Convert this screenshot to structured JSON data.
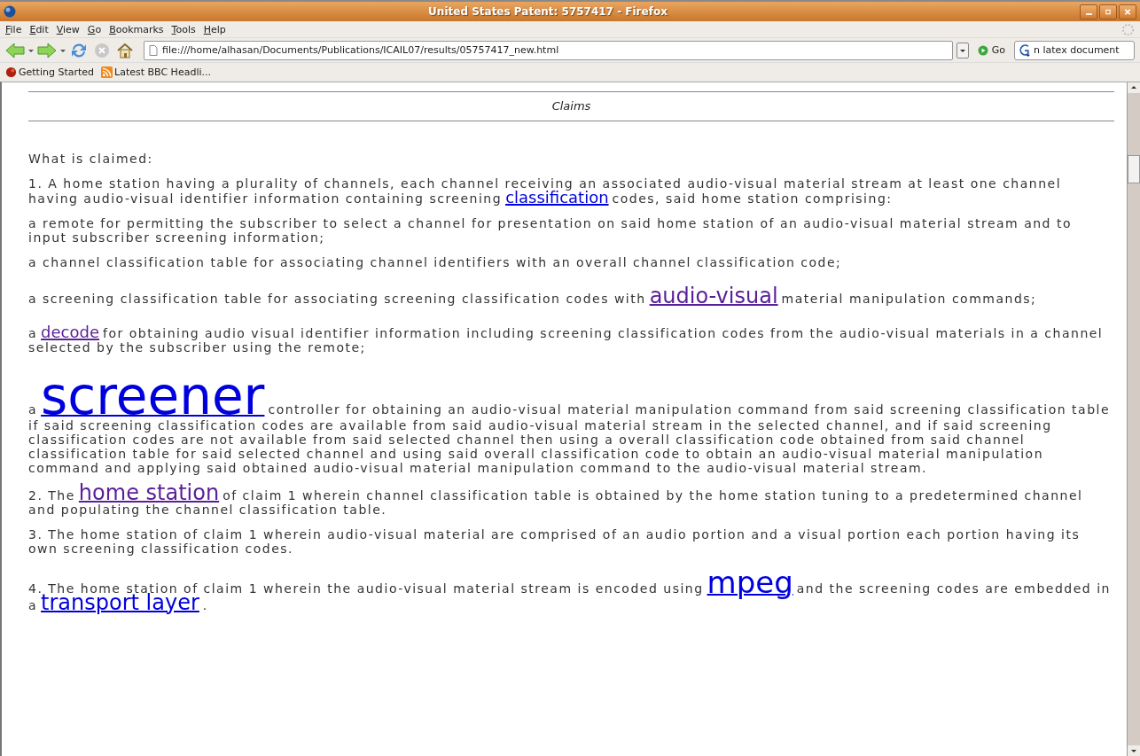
{
  "window": {
    "title": "United States Patent: 5757417 - Firefox"
  },
  "menu": [
    "File",
    "Edit",
    "View",
    "Go",
    "Bookmarks",
    "Tools",
    "Help"
  ],
  "address": {
    "value": "file:///home/alhasan/Documents/Publications/ICAIL07/results/05757417_new.html"
  },
  "go_button": "Go",
  "search": {
    "value": "n latex document"
  },
  "bookmarks": [
    {
      "label": "Getting Started",
      "kind": "page"
    },
    {
      "label": "Latest BBC Headli...",
      "kind": "feed"
    }
  ],
  "heading": "Claims",
  "paragraphs": [
    {
      "parts": [
        {
          "kind": "text",
          "text": "What is claimed:"
        }
      ]
    },
    {
      "parts": [
        {
          "kind": "text",
          "text": "1. A home station having a plurality of channels, each channel receiving an associated audio-visual material stream at least one channel having audio-visual identifier information containing screening"
        },
        {
          "kind": "small",
          "text": "classification",
          "visited": false
        },
        {
          "kind": "text",
          "text": "codes, said home station comprising:"
        }
      ]
    },
    {
      "parts": [
        {
          "kind": "text",
          "text": "a remote for permitting the subscriber to select a channel for presentation on said home station of an audio-visual material stream and to input subscriber screening information;"
        }
      ]
    },
    {
      "parts": [
        {
          "kind": "text",
          "text": "a channel classification table for associating channel identifiers with an overall channel classification code;"
        }
      ]
    },
    {
      "parts": [
        {
          "kind": "text",
          "text": "a screening classification table for associating screening classification codes with"
        },
        {
          "kind": "medium",
          "text": "audio-visual",
          "visited": true
        },
        {
          "kind": "text",
          "text": "material manipulation commands;"
        }
      ]
    },
    {
      "parts": [
        {
          "kind": "text",
          "text": "a"
        },
        {
          "kind": "small",
          "text": "decode",
          "visited": true
        },
        {
          "kind": "text",
          "text": "for obtaining audio visual identifier information including screening classification codes from the audio-visual materials in a channel selected by the subscriber using the remote;"
        }
      ]
    },
    {
      "parts": [
        {
          "kind": "text",
          "text": "a"
        },
        {
          "kind": "huge",
          "text": "screener",
          "visited": false
        },
        {
          "kind": "text",
          "text": "controller for obtaining an audio-visual material manipulation command from said screening classification table if said screening classification codes are available from said audio-visual material stream in the selected channel, and if said screening classification codes are not available from said selected channel then using a overall classification code obtained from said channel classification table for said selected channel and using said overall classification code to obtain an audio-visual material manipulation command and applying said obtained audio-visual material manipulation command to the audio-visual material stream."
        }
      ]
    },
    {
      "parts": [
        {
          "kind": "text",
          "text": "2. The"
        },
        {
          "kind": "medium",
          "text": "home station",
          "visited": true
        },
        {
          "kind": "text",
          "text": "of claim 1 wherein channel classification table is obtained by the home station tuning to a predetermined channel and populating the channel classification table."
        }
      ]
    },
    {
      "parts": [
        {
          "kind": "text",
          "text": "3. The home station of claim 1 wherein audio-visual material are comprised of an audio portion and a visual portion each portion having its own screening classification codes."
        }
      ]
    },
    {
      "parts": [
        {
          "kind": "text",
          "text": "4. The home station of claim 1 wherein the audio-visual material stream is encoded using"
        },
        {
          "kind": "large",
          "text": "mpeg",
          "visited": false
        },
        {
          "kind": "text",
          "text": "and the screening codes are embedded in a"
        },
        {
          "kind": "medium",
          "text": "transport layer",
          "visited": false
        },
        {
          "kind": "text",
          "text": "."
        }
      ]
    }
  ]
}
